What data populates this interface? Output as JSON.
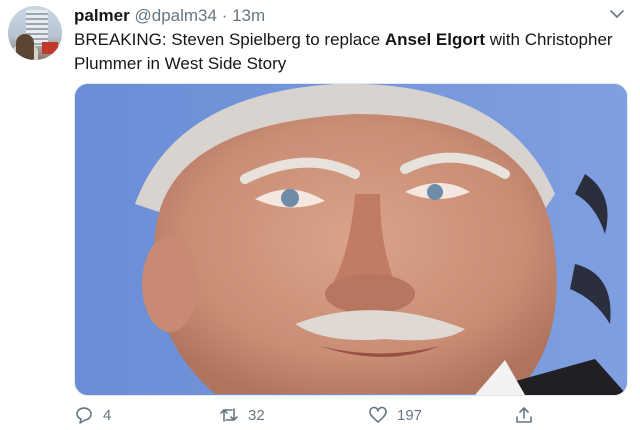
{
  "tweet": {
    "author": {
      "name": "palmer",
      "handle": "@dpalm34"
    },
    "separator": "·",
    "time": "13m",
    "text": {
      "part1": "BREAKING: Steven Spielberg to replace ",
      "bold1": "Ansel Elgort",
      "part2": " with Christopher Plummer in West Side Story"
    },
    "stats": {
      "replies": "4",
      "retweets": "32",
      "likes": "197"
    }
  },
  "icons": {
    "reply": "reply-icon",
    "retweet": "retweet-icon",
    "like": "heart-icon",
    "share": "share-icon",
    "menu": "chevron-down-icon"
  },
  "colors": {
    "text": "#14171a",
    "secondary": "#657786",
    "border": "#e1e8ed"
  }
}
